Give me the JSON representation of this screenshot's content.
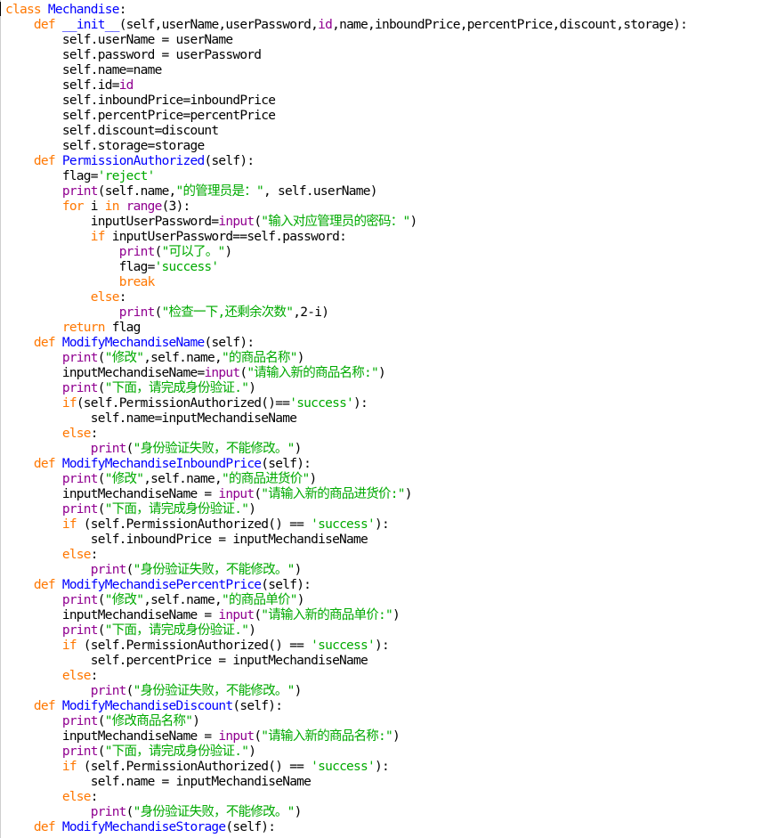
{
  "colors": {
    "background": "#ffffff",
    "keyword": "#ff7700",
    "definition": "#0000ff",
    "builtin": "#900090",
    "string": "#00aa00",
    "plain": "#000000"
  },
  "lines": [
    [
      [
        "kw",
        "class"
      ],
      [
        "plain",
        " "
      ],
      [
        "def",
        "Mechandise"
      ],
      [
        "plain",
        ":"
      ]
    ],
    [
      [
        "plain",
        "    "
      ],
      [
        "kw",
        "def"
      ],
      [
        "plain",
        " "
      ],
      [
        "def",
        "__init__"
      ],
      [
        "plain",
        "(self,userName,userPassword,"
      ],
      [
        "bi",
        "id"
      ],
      [
        "plain",
        ",name,inboundPrice,percentPrice,discount,storage):"
      ]
    ],
    [
      [
        "plain",
        "        self.userName = userName"
      ]
    ],
    [
      [
        "plain",
        "        self.password = userPassword"
      ]
    ],
    [
      [
        "plain",
        "        self.name=name"
      ]
    ],
    [
      [
        "plain",
        "        self.id="
      ],
      [
        "bi",
        "id"
      ]
    ],
    [
      [
        "plain",
        "        self.inboundPrice=inboundPrice"
      ]
    ],
    [
      [
        "plain",
        "        self.percentPrice=percentPrice"
      ]
    ],
    [
      [
        "plain",
        "        self.discount=discount"
      ]
    ],
    [
      [
        "plain",
        "        self.storage=storage"
      ]
    ],
    [
      [
        "plain",
        "    "
      ],
      [
        "kw",
        "def"
      ],
      [
        "plain",
        " "
      ],
      [
        "def",
        "PermissionAuthorized"
      ],
      [
        "plain",
        "(self):"
      ]
    ],
    [
      [
        "plain",
        "        flag="
      ],
      [
        "str",
        "'reject'"
      ]
    ],
    [
      [
        "plain",
        "        "
      ],
      [
        "bi",
        "print"
      ],
      [
        "plain",
        "(self.name,"
      ],
      [
        "str",
        "\"的管理员是：\""
      ],
      [
        "plain",
        ", self.userName)"
      ]
    ],
    [
      [
        "plain",
        "        "
      ],
      [
        "kw",
        "for"
      ],
      [
        "plain",
        " i "
      ],
      [
        "kw",
        "in"
      ],
      [
        "plain",
        " "
      ],
      [
        "bi",
        "range"
      ],
      [
        "plain",
        "(3):"
      ]
    ],
    [
      [
        "plain",
        "            inputUserPassword="
      ],
      [
        "bi",
        "input"
      ],
      [
        "plain",
        "("
      ],
      [
        "str",
        "\"输入对应管理员的密码：\""
      ],
      [
        "plain",
        ")"
      ]
    ],
    [
      [
        "plain",
        "            "
      ],
      [
        "kw",
        "if"
      ],
      [
        "plain",
        " inputUserPassword==self.password:"
      ]
    ],
    [
      [
        "plain",
        "                "
      ],
      [
        "bi",
        "print"
      ],
      [
        "plain",
        "("
      ],
      [
        "str",
        "\"可以了。\""
      ],
      [
        "plain",
        ")"
      ]
    ],
    [
      [
        "plain",
        "                flag="
      ],
      [
        "str",
        "'success'"
      ]
    ],
    [
      [
        "plain",
        "                "
      ],
      [
        "kw",
        "break"
      ]
    ],
    [
      [
        "plain",
        "            "
      ],
      [
        "kw",
        "else"
      ],
      [
        "plain",
        ":"
      ]
    ],
    [
      [
        "plain",
        "                "
      ],
      [
        "bi",
        "print"
      ],
      [
        "plain",
        "("
      ],
      [
        "str",
        "\"检查一下,还剩余次数\""
      ],
      [
        "plain",
        ",2-i)"
      ]
    ],
    [
      [
        "plain",
        "        "
      ],
      [
        "kw",
        "return"
      ],
      [
        "plain",
        " flag"
      ]
    ],
    [
      [
        "plain",
        "    "
      ],
      [
        "kw",
        "def"
      ],
      [
        "plain",
        " "
      ],
      [
        "def",
        "ModifyMechandiseName"
      ],
      [
        "plain",
        "(self):"
      ]
    ],
    [
      [
        "plain",
        "        "
      ],
      [
        "bi",
        "print"
      ],
      [
        "plain",
        "("
      ],
      [
        "str",
        "\"修改\""
      ],
      [
        "plain",
        ",self.name,"
      ],
      [
        "str",
        "\"的商品名称\""
      ],
      [
        "plain",
        ")"
      ]
    ],
    [
      [
        "plain",
        "        inputMechandiseName="
      ],
      [
        "bi",
        "input"
      ],
      [
        "plain",
        "("
      ],
      [
        "str",
        "\"请输入新的商品名称:\""
      ],
      [
        "plain",
        ")"
      ]
    ],
    [
      [
        "plain",
        "        "
      ],
      [
        "bi",
        "print"
      ],
      [
        "plain",
        "("
      ],
      [
        "str",
        "\"下面，请完成身份验证.\""
      ],
      [
        "plain",
        ")"
      ]
    ],
    [
      [
        "plain",
        "        "
      ],
      [
        "kw",
        "if"
      ],
      [
        "plain",
        "(self.PermissionAuthorized()=="
      ],
      [
        "str",
        "'success'"
      ],
      [
        "plain",
        "):"
      ]
    ],
    [
      [
        "plain",
        "            self.name=inputMechandiseName"
      ]
    ],
    [
      [
        "plain",
        "        "
      ],
      [
        "kw",
        "else"
      ],
      [
        "plain",
        ":"
      ]
    ],
    [
      [
        "plain",
        "            "
      ],
      [
        "bi",
        "print"
      ],
      [
        "plain",
        "("
      ],
      [
        "str",
        "\"身份验证失败，不能修改。\""
      ],
      [
        "plain",
        ")"
      ]
    ],
    [
      [
        "plain",
        "    "
      ],
      [
        "kw",
        "def"
      ],
      [
        "plain",
        " "
      ],
      [
        "def",
        "ModifyMechandiseInboundPrice"
      ],
      [
        "plain",
        "(self):"
      ]
    ],
    [
      [
        "plain",
        "        "
      ],
      [
        "bi",
        "print"
      ],
      [
        "plain",
        "("
      ],
      [
        "str",
        "\"修改\""
      ],
      [
        "plain",
        ",self.name,"
      ],
      [
        "str",
        "\"的商品进货价\""
      ],
      [
        "plain",
        ")"
      ]
    ],
    [
      [
        "plain",
        "        inputMechandiseName = "
      ],
      [
        "bi",
        "input"
      ],
      [
        "plain",
        "("
      ],
      [
        "str",
        "\"请输入新的商品进货价:\""
      ],
      [
        "plain",
        ")"
      ]
    ],
    [
      [
        "plain",
        "        "
      ],
      [
        "bi",
        "print"
      ],
      [
        "plain",
        "("
      ],
      [
        "str",
        "\"下面，请完成身份验证.\""
      ],
      [
        "plain",
        ")"
      ]
    ],
    [
      [
        "plain",
        "        "
      ],
      [
        "kw",
        "if"
      ],
      [
        "plain",
        " (self.PermissionAuthorized() == "
      ],
      [
        "str",
        "'success'"
      ],
      [
        "plain",
        "):"
      ]
    ],
    [
      [
        "plain",
        "            self.inboundPrice = inputMechandiseName"
      ]
    ],
    [
      [
        "plain",
        "        "
      ],
      [
        "kw",
        "else"
      ],
      [
        "plain",
        ":"
      ]
    ],
    [
      [
        "plain",
        "            "
      ],
      [
        "bi",
        "print"
      ],
      [
        "plain",
        "("
      ],
      [
        "str",
        "\"身份验证失败，不能修改。\""
      ],
      [
        "plain",
        ")"
      ]
    ],
    [
      [
        "plain",
        "    "
      ],
      [
        "kw",
        "def"
      ],
      [
        "plain",
        " "
      ],
      [
        "def",
        "ModifyMechandisePercentPrice"
      ],
      [
        "plain",
        "(self):"
      ]
    ],
    [
      [
        "plain",
        "        "
      ],
      [
        "bi",
        "print"
      ],
      [
        "plain",
        "("
      ],
      [
        "str",
        "\"修改\""
      ],
      [
        "plain",
        ",self.name,"
      ],
      [
        "str",
        "\"的商品单价\""
      ],
      [
        "plain",
        ")"
      ]
    ],
    [
      [
        "plain",
        "        inputMechandiseName = "
      ],
      [
        "bi",
        "input"
      ],
      [
        "plain",
        "("
      ],
      [
        "str",
        "\"请输入新的商品单价:\""
      ],
      [
        "plain",
        ")"
      ]
    ],
    [
      [
        "plain",
        "        "
      ],
      [
        "bi",
        "print"
      ],
      [
        "plain",
        "("
      ],
      [
        "str",
        "\"下面，请完成身份验证.\""
      ],
      [
        "plain",
        ")"
      ]
    ],
    [
      [
        "plain",
        "        "
      ],
      [
        "kw",
        "if"
      ],
      [
        "plain",
        " (self.PermissionAuthorized() == "
      ],
      [
        "str",
        "'success'"
      ],
      [
        "plain",
        "):"
      ]
    ],
    [
      [
        "plain",
        "            self.percentPrice = inputMechandiseName"
      ]
    ],
    [
      [
        "plain",
        "        "
      ],
      [
        "kw",
        "else"
      ],
      [
        "plain",
        ":"
      ]
    ],
    [
      [
        "plain",
        "            "
      ],
      [
        "bi",
        "print"
      ],
      [
        "plain",
        "("
      ],
      [
        "str",
        "\"身份验证失败，不能修改。\""
      ],
      [
        "plain",
        ")"
      ]
    ],
    [
      [
        "plain",
        "    "
      ],
      [
        "kw",
        "def"
      ],
      [
        "plain",
        " "
      ],
      [
        "def",
        "ModifyMechandiseDiscount"
      ],
      [
        "plain",
        "(self):"
      ]
    ],
    [
      [
        "plain",
        "        "
      ],
      [
        "bi",
        "print"
      ],
      [
        "plain",
        "("
      ],
      [
        "str",
        "\"修改商品名称\""
      ],
      [
        "plain",
        ")"
      ]
    ],
    [
      [
        "plain",
        "        inputMechandiseName = "
      ],
      [
        "bi",
        "input"
      ],
      [
        "plain",
        "("
      ],
      [
        "str",
        "\"请输入新的商品名称:\""
      ],
      [
        "plain",
        ")"
      ]
    ],
    [
      [
        "plain",
        "        "
      ],
      [
        "bi",
        "print"
      ],
      [
        "plain",
        "("
      ],
      [
        "str",
        "\"下面，请完成身份验证.\""
      ],
      [
        "plain",
        ")"
      ]
    ],
    [
      [
        "plain",
        "        "
      ],
      [
        "kw",
        "if"
      ],
      [
        "plain",
        " (self.PermissionAuthorized() == "
      ],
      [
        "str",
        "'success'"
      ],
      [
        "plain",
        "):"
      ]
    ],
    [
      [
        "plain",
        "            self.name = inputMechandiseName"
      ]
    ],
    [
      [
        "plain",
        "        "
      ],
      [
        "kw",
        "else"
      ],
      [
        "plain",
        ":"
      ]
    ],
    [
      [
        "plain",
        "            "
      ],
      [
        "bi",
        "print"
      ],
      [
        "plain",
        "("
      ],
      [
        "str",
        "\"身份验证失败，不能修改。\""
      ],
      [
        "plain",
        ")"
      ]
    ],
    [
      [
        "plain",
        "    "
      ],
      [
        "kw",
        "def"
      ],
      [
        "plain",
        " "
      ],
      [
        "def",
        "ModifyMechandiseStorage"
      ],
      [
        "plain",
        "(self):"
      ]
    ]
  ]
}
